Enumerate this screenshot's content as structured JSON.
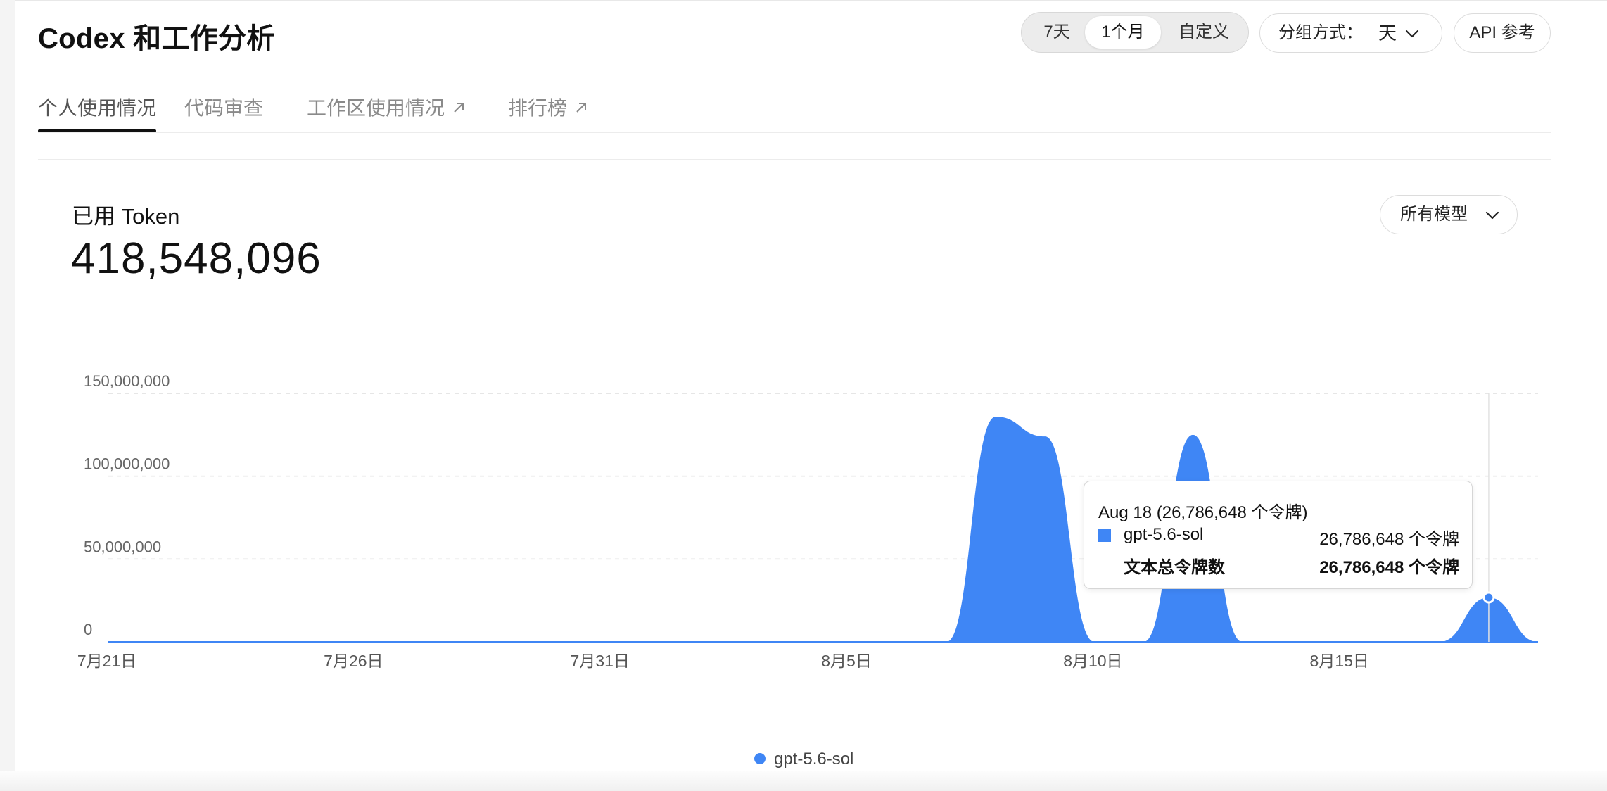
{
  "header": {
    "title": "Codex 和工作分析",
    "range_options": [
      "7天",
      "1个月",
      "自定义"
    ],
    "range_selected": "1个月",
    "group_label": "分组方式：",
    "group_value": "天",
    "api_label": "API 参考"
  },
  "tabs": [
    {
      "label": "个人使用情况",
      "active": true,
      "external": false
    },
    {
      "label": "代码审查",
      "active": false,
      "external": false
    },
    {
      "label": "工作区使用情况",
      "active": false,
      "external": true
    },
    {
      "label": "排行榜",
      "active": false,
      "external": true
    }
  ],
  "metric": {
    "label": "已用 Token",
    "value": "418,548,096",
    "model_filter": "所有模型"
  },
  "colors": {
    "series": "#3f86f5",
    "grid": "#dddddd",
    "text": "#111111"
  },
  "chart_data": {
    "type": "area",
    "x": [
      "7月21日",
      "7月22日",
      "7月23日",
      "7月24日",
      "7月25日",
      "7月26日",
      "7月27日",
      "7月28日",
      "7月29日",
      "7月30日",
      "7月31日",
      "8月1日",
      "8月2日",
      "8月3日",
      "8月4日",
      "8月5日",
      "8月6日",
      "8月7日",
      "8月8日",
      "8月9日",
      "8月10日",
      "8月11日",
      "8月12日",
      "8月13日",
      "8月14日",
      "8月15日",
      "8月16日",
      "8月17日",
      "8月18日",
      "8月19日"
    ],
    "x_ticks": [
      "7月21日",
      "7月26日",
      "7月31日",
      "8月5日",
      "8月10日",
      "8月15日"
    ],
    "series": [
      {
        "name": "gpt-5.6-sol",
        "values": [
          0,
          0,
          0,
          0,
          0,
          0,
          0,
          0,
          0,
          0,
          0,
          0,
          0,
          0,
          0,
          0,
          0,
          0,
          136000000,
          124000000,
          0,
          0,
          125000000,
          0,
          0,
          0,
          0,
          0,
          26786648,
          0
        ]
      }
    ],
    "y_ticks": [
      "0",
      "50,000,000",
      "100,000,000",
      "150,000,000"
    ],
    "ylim": [
      0,
      150000000
    ],
    "grid": true,
    "legend": "bottom",
    "highlight": "8月18日"
  },
  "tooltip": {
    "title": "Aug 18 (26,786,648 个令牌)",
    "rows": [
      {
        "name": "gpt-5.6-sol",
        "value": "26,786,648 个令牌"
      },
      {
        "name": "文本总令牌数",
        "value": "26,786,648 个令牌"
      }
    ]
  }
}
